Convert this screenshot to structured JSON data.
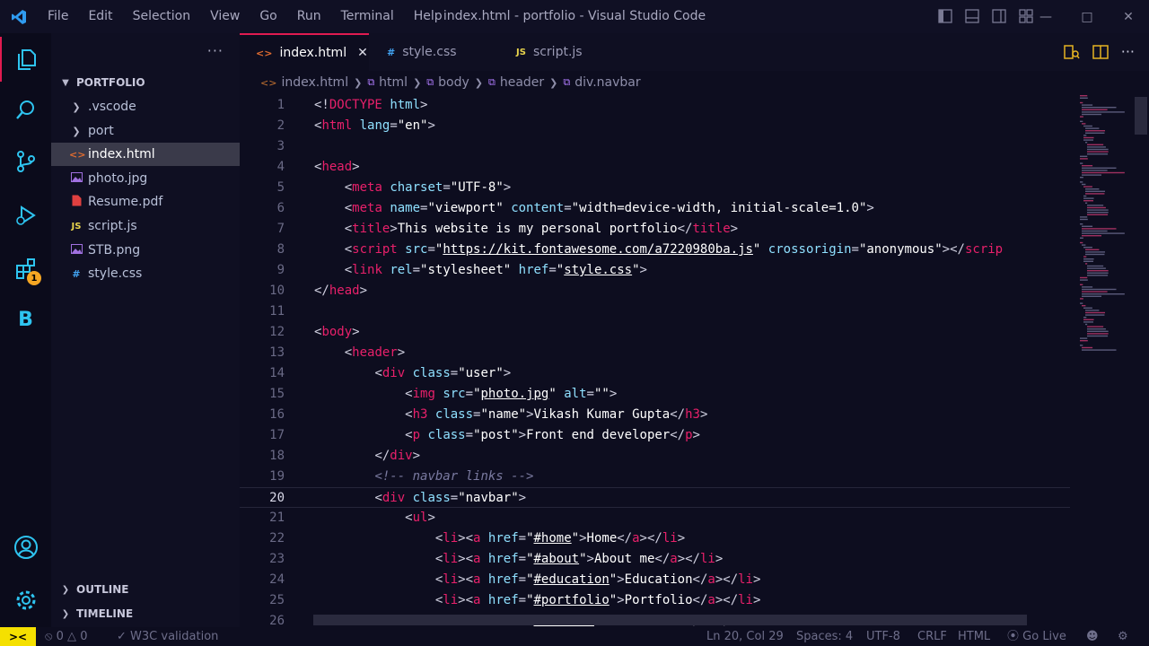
{
  "titlebar": {
    "menu": [
      "File",
      "Edit",
      "Selection",
      "View",
      "Go",
      "Run",
      "Terminal",
      "Help"
    ],
    "title": "index.html - portfolio - Visual Studio Code"
  },
  "sidebar": {
    "explorer_title": "PORTFOLIO",
    "items": [
      {
        "label": ".vscode",
        "icon": "chevron-right-icon",
        "kind": "folder"
      },
      {
        "label": "port",
        "icon": "chevron-right-icon",
        "kind": "folder"
      },
      {
        "label": "index.html",
        "icon": "html-file-icon",
        "kind": "file",
        "selected": true
      },
      {
        "label": "photo.jpg",
        "icon": "image-file-icon",
        "kind": "file"
      },
      {
        "label": "Resume.pdf",
        "icon": "pdf-file-icon",
        "kind": "file"
      },
      {
        "label": "script.js",
        "icon": "js-file-icon",
        "kind": "file"
      },
      {
        "label": "STB.png",
        "icon": "image-file-icon",
        "kind": "file"
      },
      {
        "label": "style.css",
        "icon": "css-file-icon",
        "kind": "file"
      }
    ],
    "outline_label": "OUTLINE",
    "timeline_label": "TIMELINE",
    "extensions_badge": "1"
  },
  "tabs": [
    {
      "label": "index.html",
      "icon_glyph": "<>",
      "active": true
    },
    {
      "label": "style.css",
      "icon_glyph": "#",
      "active": false
    },
    {
      "label": "script.js",
      "icon_glyph": "JS",
      "active": false
    }
  ],
  "breadcrumb": [
    "index.html",
    "html",
    "body",
    "header",
    "div.navbar"
  ],
  "editor": {
    "current_line": 20,
    "line_numbers": [
      "1",
      "2",
      "3",
      "4",
      "5",
      "6",
      "7",
      "8",
      "9",
      "10",
      "11",
      "12",
      "13",
      "14",
      "15",
      "16",
      "17",
      "18",
      "19",
      "20",
      "21",
      "22",
      "23",
      "24",
      "25",
      "26"
    ],
    "lines": [
      "<!DOCTYPE html>",
      "<html lang=\"en\">",
      "",
      "<head>",
      "    <meta charset=\"UTF-8\">",
      "    <meta name=\"viewport\" content=\"width=device-width, initial-scale=1.0\">",
      "    <title>This website is my personal portfolio</title>",
      "    <script src=\"https://kit.fontawesome.com/a7220980ba.js\" crossorigin=\"anonymous\"></scrip",
      "    <link rel=\"stylesheet\" href=\"style.css\">",
      "</head>",
      "",
      "<body>",
      "    <header>",
      "        <div class=\"user\">",
      "            <img src=\"photo.jpg\" alt=\"\">",
      "            <h3 class=\"name\">Vikash Kumar Gupta</h3>",
      "            <p class=\"post\">Front end developer</p>",
      "        </div>",
      "        <!-- navbar links -->",
      "        <div class=\"navbar\">",
      "            <ul>",
      "                <li><a href=\"#home\">Home</a></li>",
      "                <li><a href=\"#about\">About me</a></li>",
      "                <li><a href=\"#education\">Education</a></li>",
      "                <li><a href=\"#portfolio\">Portfolio</a></li>",
      "                <li><a href=\"#contact\">Contact Me</a></li>"
    ]
  },
  "statusbar": {
    "remote_glyph": "><",
    "errors": "0",
    "warnings": "0",
    "w3c": "W3C validation",
    "position": "Ln 20, Col 29",
    "spaces": "Spaces: 4",
    "encoding": "UTF-8",
    "eol": "CRLF",
    "language": "HTML",
    "golive": "Go Live"
  },
  "colors": {
    "accent": "#e01b50",
    "tag": "#e8206a",
    "attribute": "#8fe0ff",
    "badge": "#f5a623"
  }
}
